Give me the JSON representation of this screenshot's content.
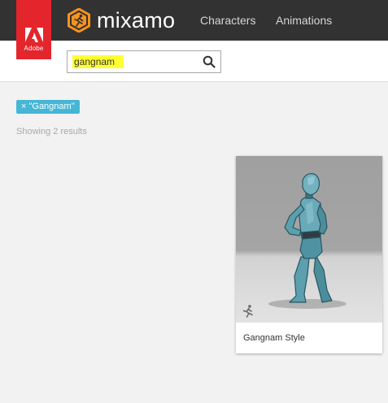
{
  "brand": {
    "adobe_label": "Adobe",
    "name": "mixamo",
    "accent_color": "#f7931e",
    "adobe_color": "#e4252b"
  },
  "nav": {
    "items": [
      {
        "label": "Characters"
      },
      {
        "label": "Animations"
      }
    ]
  },
  "search": {
    "value": "gangnam",
    "icon": "search-icon"
  },
  "filter": {
    "tag_label": "× \"Gangnam\"",
    "tag_color": "#45b6d6"
  },
  "results": {
    "count_text": "Showing 2 results"
  },
  "cards": [
    {
      "title": "Gangnam Style",
      "icon": "running-figure-icon"
    }
  ]
}
